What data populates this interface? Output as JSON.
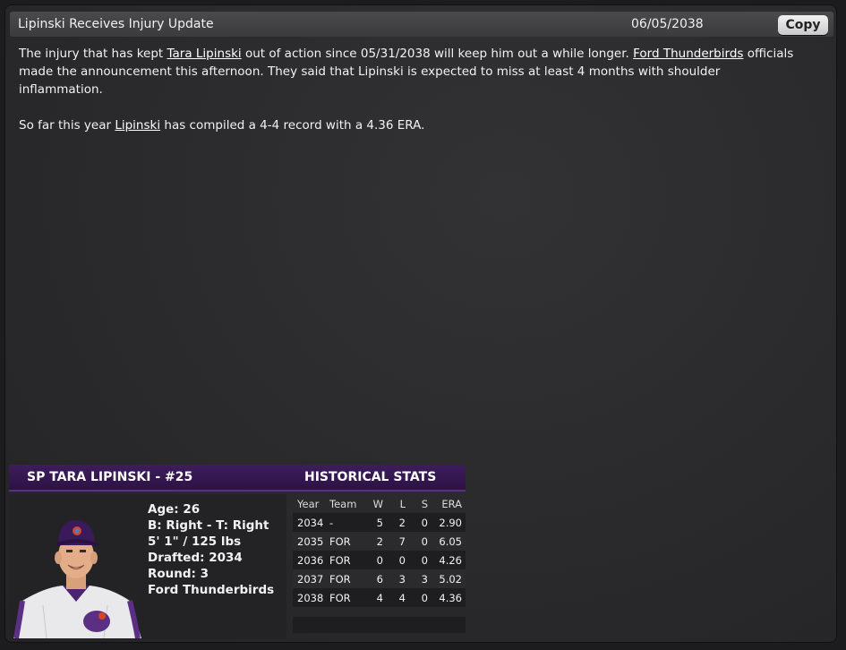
{
  "header": {
    "title": "Lipinski Receives Injury Update",
    "date": "06/05/2038",
    "copy_label": "Copy"
  },
  "article": {
    "p1_a": "The injury that has kept ",
    "p1_player": "Tara Lipinski",
    "p1_b": " out of action since 05/31/2038 will keep him out a while longer. ",
    "p1_team": "Ford Thunderbirds",
    "p1_c": " officials made the announcement this afternoon. They said that Lipinski is expected to miss at least 4 months with shoulder inflammation.",
    "p2_a": "So far this year ",
    "p2_player": "Lipinski",
    "p2_b": " has compiled a 4-4 record with a 4.36 ERA."
  },
  "player": {
    "name_header": "SP TARA LIPINSKI - #25",
    "age": "Age: 26",
    "bats_throws": "B: Right - T: Right",
    "height_weight": "5' 1\" / 125 lbs",
    "drafted": "Drafted: 2034",
    "round": "Round: 3",
    "team": "Ford Thunderbirds"
  },
  "historical": {
    "title": "HISTORICAL STATS",
    "columns": [
      "Year",
      "Team",
      "W",
      "L",
      "S",
      "ERA"
    ],
    "rows": [
      [
        "2034",
        "-",
        "5",
        "2",
        "0",
        "2.90"
      ],
      [
        "2035",
        "FOR",
        "2",
        "7",
        "0",
        "6.05"
      ],
      [
        "2036",
        "FOR",
        "0",
        "0",
        "0",
        "4.26"
      ],
      [
        "2037",
        "FOR",
        "6",
        "3",
        "3",
        "5.02"
      ],
      [
        "2038",
        "FOR",
        "4",
        "4",
        "0",
        "4.36"
      ]
    ]
  },
  "colors": {
    "header_purple": "#3d1d5c",
    "accent_purple": "#5a2f84"
  }
}
